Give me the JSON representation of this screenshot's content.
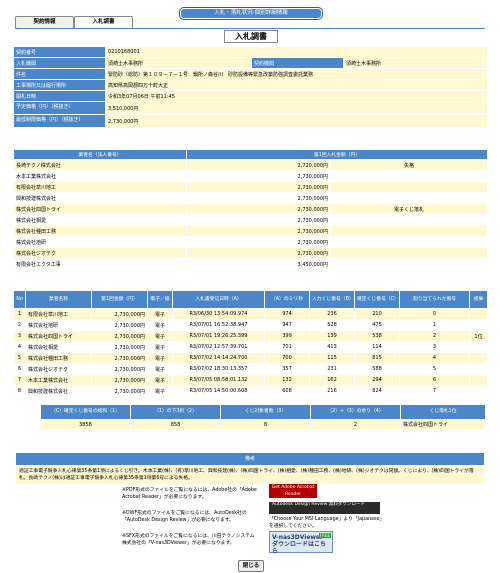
{
  "header": {
    "title": "入札・落札状況-個別詳細情報"
  },
  "tabs": [
    {
      "label": "契約情報"
    },
    {
      "label": "入札調書"
    }
  ],
  "page_title": "入札調書",
  "info": {
    "contract_no_label": "契約番号",
    "contract_no": "0210168001",
    "agency_label": "入札機関",
    "agency": "須崎土木事務所",
    "contract_agency_label": "契約機関",
    "contract_agency": "須崎土木事務所",
    "name_label": "件名",
    "name": "緊防砂（総防）第１０９－７－１号　鍋所ノ森谷川　砂防設備等緊急改築防強調査委託業務",
    "place_label": "工事場所又は履行場所",
    "place": "高知県高岡郡四万十町大正",
    "date_label": "開札日時",
    "date": "令和3年07月06日 午前11:45",
    "estimate_label": "予定価格（円）（税抜き）",
    "estimate": "3,510,000円",
    "min_label": "最低制限価格（円）（税抜き）",
    "min": "2,730,000円"
  },
  "bids": {
    "headers": [
      "業者名（法人番号）",
      "第1回入札金額（円）"
    ],
    "rows": [
      {
        "name": "長崎テクノ株式会社",
        "amount": "2,720,000円",
        "note": "失格"
      },
      {
        "name": "木本工業株式会社",
        "amount": "2,730,000円",
        "note": ""
      },
      {
        "name": "有限会社草川地工",
        "amount": "2,730,000円",
        "note": ""
      },
      {
        "name": "興和技建株式会社",
        "amount": "2,730,000円",
        "note": ""
      },
      {
        "name": "株式会社四国トライ",
        "amount": "2,730,000円",
        "note": "電子くじ落札"
      },
      {
        "name": "株式会社相愛",
        "amount": "2,730,000円",
        "note": ""
      },
      {
        "name": "株式会社種田工務",
        "amount": "2,730,000円",
        "note": ""
      },
      {
        "name": "株式会社地研",
        "amount": "2,730,000円",
        "note": ""
      },
      {
        "name": "株式会社ジオテク",
        "amount": "2,730,000円",
        "note": ""
      },
      {
        "name": "有限会社エクタ工事",
        "amount": "3,450,000円",
        "note": ""
      }
    ]
  },
  "lottery": {
    "headers": [
      "No",
      "業者名称",
      "第1回金額（円）",
      "電子／紙",
      "入札書受信日時（A）",
      "（A）のミリ秒",
      "入力くじ番号（B）",
      "確定くじ番号（C）",
      "割り当てられた番号",
      "結果"
    ],
    "rows": [
      {
        "no": "1",
        "name": "有限会社草川地工",
        "amount": "2,730,000円",
        "type": "電子",
        "datetime": "R3/06/30 13:54:09.974",
        "ms": "974",
        "inp": "236",
        "fix": "210",
        "assigned": "0",
        "result": ""
      },
      {
        "no": "2",
        "name": "株式会社地研",
        "amount": "2,730,000円",
        "type": "電子",
        "datetime": "R3/07/01 16:52:38.947",
        "ms": "947",
        "inp": "528",
        "fix": "475",
        "assigned": "1",
        "result": ""
      },
      {
        "no": "3",
        "name": "株式会社四国トライ",
        "amount": "2,730,000円",
        "type": "電子",
        "datetime": "R3/07/01 19:26:25.399",
        "ms": "399",
        "inp": "139",
        "fix": "538",
        "assigned": "2",
        "result": "1位"
      },
      {
        "no": "4",
        "name": "株式会社相愛",
        "amount": "2,730,000円",
        "type": "電子",
        "datetime": "R3/07/02 12:57:39.701",
        "ms": "701",
        "inp": "413",
        "fix": "114",
        "assigned": "3",
        "result": ""
      },
      {
        "no": "5",
        "name": "株式会社種田工務",
        "amount": "2,730,000円",
        "type": "電子",
        "datetime": "R3/07/02 14:14:24.700",
        "ms": "700",
        "inp": "115",
        "fix": "815",
        "assigned": "4",
        "result": ""
      },
      {
        "no": "6",
        "name": "株式会社ジオテク",
        "amount": "2,730,000円",
        "type": "電子",
        "datetime": "R3/07/02 18:30:13.357",
        "ms": "357",
        "inp": "231",
        "fix": "588",
        "assigned": "5",
        "result": ""
      },
      {
        "no": "7",
        "name": "木本工業株式会社",
        "amount": "2,730,000円",
        "type": "電子",
        "datetime": "R3/07/05 08:58:01.132",
        "ms": "132",
        "inp": "162",
        "fix": "294",
        "assigned": "6",
        "result": ""
      },
      {
        "no": "8",
        "name": "興和技建株式会社",
        "amount": "2,730,000円",
        "type": "電子",
        "datetime": "R3/07/05 14:50:00.608",
        "ms": "608",
        "inp": "216",
        "fix": "824",
        "assigned": "7",
        "result": ""
      }
    ]
  },
  "summary": {
    "headers": [
      "（C）確定くじ番号の総和（1）",
      "（1）の下3桁（2）",
      "くじ対象者数（3）",
      "（2）÷（3）の余り（4）",
      "くじ落札1位"
    ],
    "values": [
      "3858",
      "858",
      "8",
      "2",
      "株式会社四国トライ"
    ]
  },
  "notes": {
    "title": "備考",
    "text": "適証工事電子競争入札心律第35条第1項によるくじ引き。木本工業(株)、(有)草川地工、興和技建(株)、(株)四国トライ、(株)相愛、(株)種田工務、(株)地研、(株)ジオテクは同額。くじにより、(株)四国トライが落札。長崎テクノ(株)は適証工事電子競争入札心律第35条第1項第6号による失格。"
  },
  "downloads": {
    "pdf_text": "※PDF形式のファイルをご覧になるには、Adobe社の「Adobe Acrobat Reader」が必要になります。",
    "dwf_text": "※DWF形式のファイルをご覧になるには、AutoDesk社の「AutoDesk Design Review」が必要になります。",
    "sfx_text": "※SFX形式のファイルをご覧になるには、川田テクノシステム株式会社の「V-nas3DViewer」が必要になります。",
    "adobe_badge": "Get Adobe Acrobat Reader",
    "autodesk_badge": "Autodesk Design Review 無料ダウンロード",
    "autodesk_note": "「Choose Your MSI Language」より「Japanese」を選択してください。",
    "vnas_badge": "V-nas3DViewer ダウンロードはこちら",
    "vnas_free": "FREE"
  },
  "close_label": "閉じる"
}
